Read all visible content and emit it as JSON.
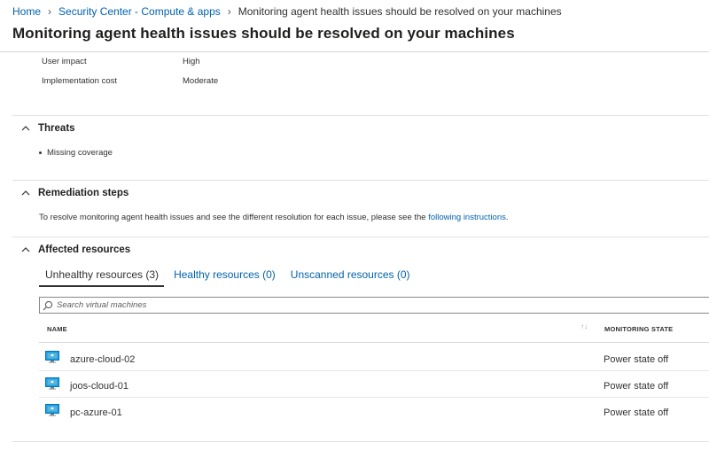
{
  "breadcrumb": {
    "home": "Home",
    "parent": "Security Center - Compute & apps",
    "current": "Monitoring agent health issues should be resolved on your machines"
  },
  "page_title": "Monitoring agent health issues should be resolved on your machines",
  "details": {
    "user_impact_label": "User impact",
    "user_impact_value": "High",
    "implementation_cost_label": "Implementation cost",
    "implementation_cost_value": "Moderate"
  },
  "threats": {
    "title": "Threats",
    "items": [
      "Missing coverage"
    ]
  },
  "remediation": {
    "title": "Remediation steps",
    "text": "To resolve monitoring agent health issues and see the different resolution for each issue, please see the",
    "link_text": "following instructions",
    "trailing": "."
  },
  "affected": {
    "title": "Affected resources",
    "tabs": [
      {
        "label": "Unhealthy resources (3)",
        "active": true
      },
      {
        "label": "Healthy resources (0)",
        "active": false
      },
      {
        "label": "Unscanned resources (0)",
        "active": false
      }
    ],
    "search_placeholder": "Search virtual machines",
    "columns": {
      "name": "NAME",
      "state": "MONITORING STATE"
    },
    "rows": [
      {
        "name": "azure-cloud-02",
        "state": "Power state off"
      },
      {
        "name": "joos-cloud-01",
        "state": "Power state off"
      },
      {
        "name": "pc-azure-01",
        "state": "Power state off"
      }
    ]
  },
  "colors": {
    "link": "#0062ad",
    "vm_icon": "#1ba1e2",
    "text": "#323130"
  },
  "icons": {
    "breadcrumb_separator": "chevron-right-icon",
    "section_toggle": "chevron-up-icon",
    "search": "search-icon",
    "sort": "sort-icon",
    "resource": "virtual-machine-icon"
  }
}
